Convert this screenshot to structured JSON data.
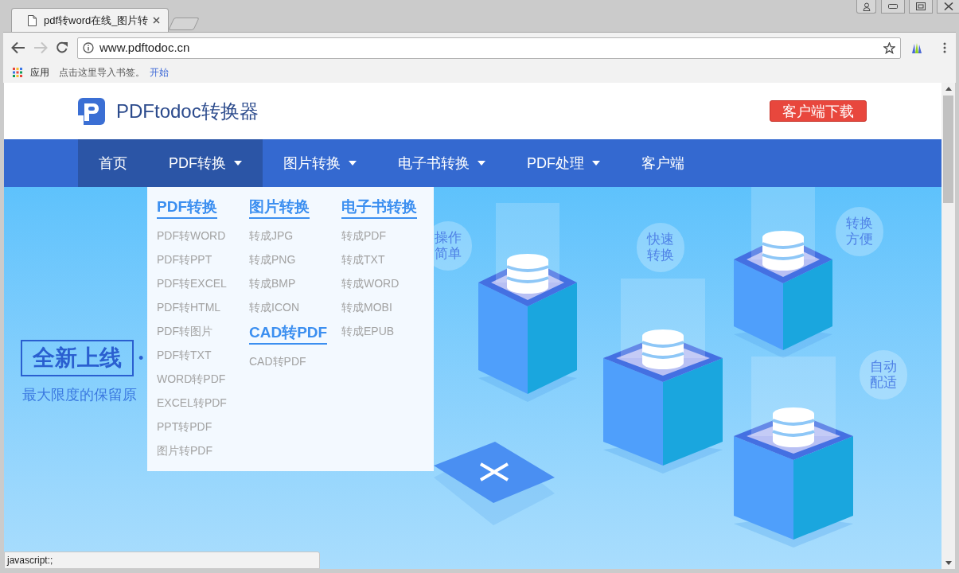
{
  "browser": {
    "tabs": [
      {
        "title": "pdf转word在线_图片转",
        "selected": true
      }
    ],
    "address": "www.pdftodoc.cn",
    "bookmarks": [
      {
        "label": "应用",
        "kind": "apps"
      },
      {
        "label": "点击这里导入书签。",
        "kind": "text"
      },
      {
        "label": "开始",
        "kind": "link"
      }
    ],
    "status_bar": "javascript:;"
  },
  "page": {
    "logo": "PDFtodoc转换器",
    "download_button": "客户端下载",
    "nav": [
      {
        "label": "首页",
        "dropdown": false,
        "highlighted": true
      },
      {
        "label": "PDF转换",
        "dropdown": true,
        "highlighted": true
      },
      {
        "label": "图片转换",
        "dropdown": true,
        "highlighted": false
      },
      {
        "label": "电子书转换",
        "dropdown": true,
        "highlighted": false
      },
      {
        "label": "PDF处理",
        "dropdown": true,
        "highlighted": false
      },
      {
        "label": "客户端",
        "dropdown": false,
        "highlighted": false
      }
    ],
    "dropdown": {
      "columns": [
        [
          {
            "heading": "PDF转换",
            "items": [
              "PDF转WORD",
              "PDF转PPT",
              "PDF转EXCEL",
              "PDF转HTML",
              "PDF转图片",
              "PDF转TXT",
              "WORD转PDF",
              "EXCEL转PDF",
              "PPT转PDF",
              "图片转PDF"
            ]
          }
        ],
        [
          {
            "heading": "图片转换",
            "items": [
              "转成JPG",
              "转成PNG",
              "转成BMP",
              "转成ICON"
            ]
          },
          {
            "heading": "CAD转PDF",
            "items": [
              "CAD转PDF"
            ]
          }
        ],
        [
          {
            "heading": "电子书转换",
            "items": [
              "转成PDF",
              "转成TXT",
              "转成WORD",
              "转成MOBI",
              "转成EPUB"
            ]
          }
        ]
      ]
    },
    "hero": {
      "badge": "全新上线",
      "bullet": "•",
      "subtitle": "最大限度的保留原",
      "bubbles": [
        "操作简单",
        "快速转换",
        "转换方便",
        "自动配适"
      ]
    }
  }
}
